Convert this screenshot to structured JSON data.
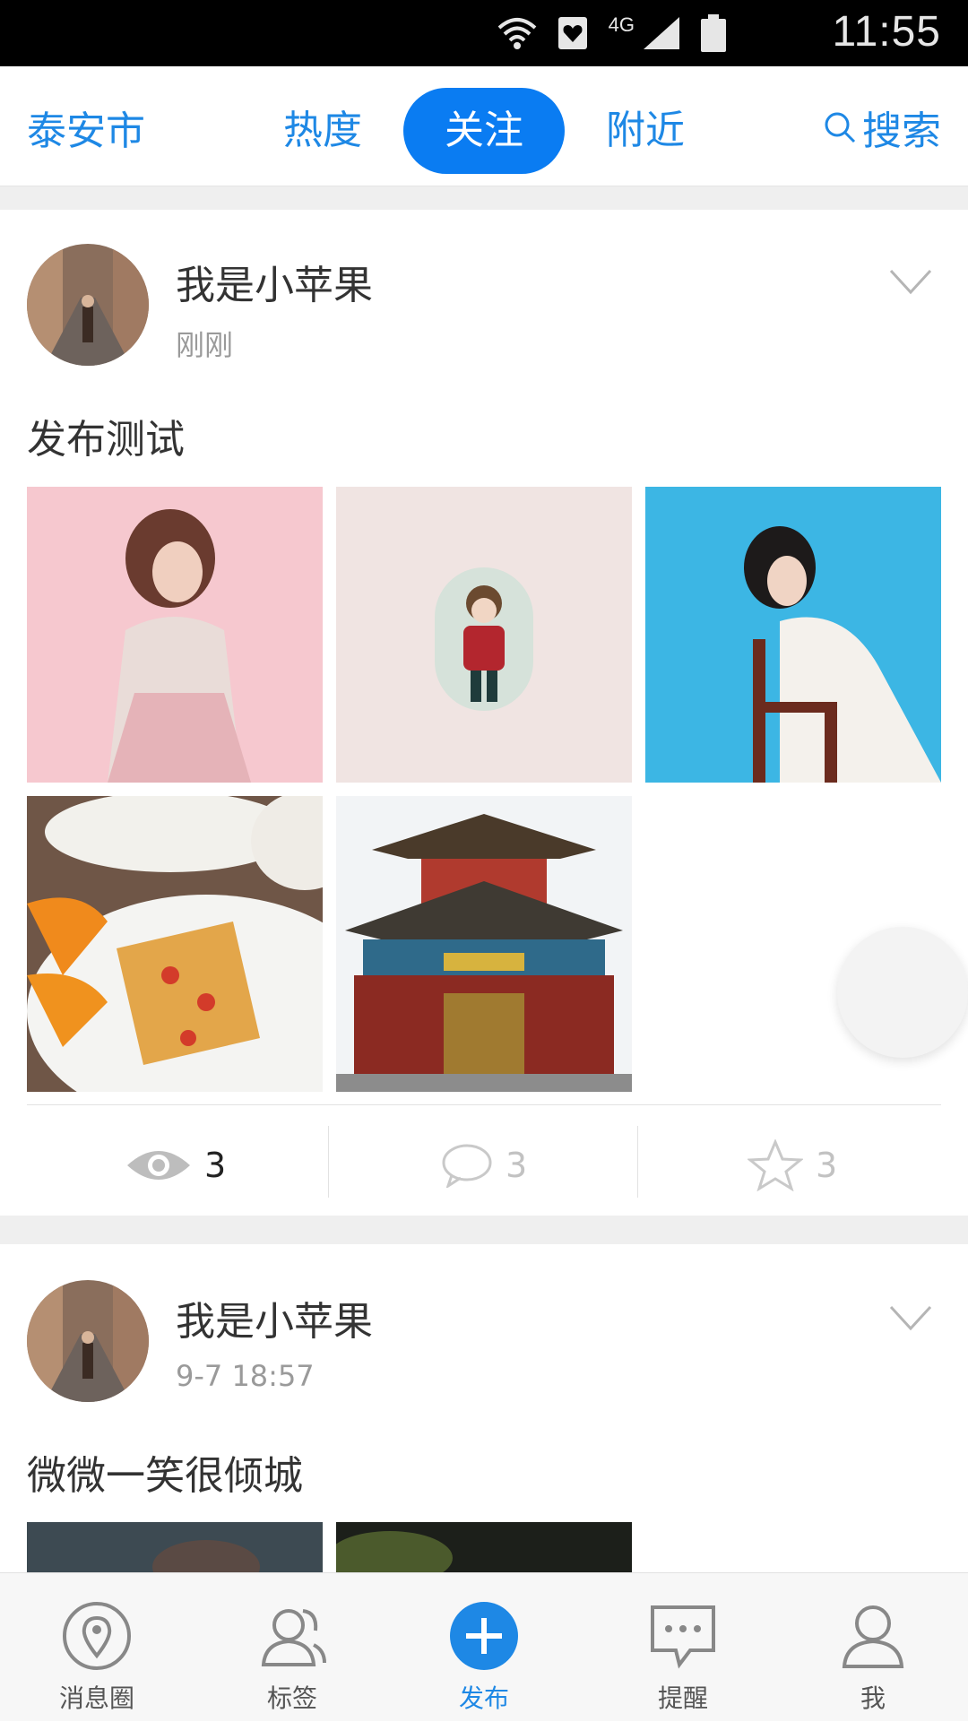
{
  "status_bar": {
    "network": "4G",
    "time": "11:55"
  },
  "top_nav": {
    "city": "泰安市",
    "tabs": [
      {
        "label": "热度",
        "active": false
      },
      {
        "label": "关注",
        "active": true
      },
      {
        "label": "附近",
        "active": false
      }
    ],
    "search_label": "搜索"
  },
  "posts": [
    {
      "username": "我是小苹果",
      "time": "刚刚",
      "text": "发布测试",
      "images": [
        "pink-portrait-photo",
        "cartoon-boy-illustration",
        "blue-portrait-chair-photo",
        "food-plate-photo",
        "pagoda-temple-photo"
      ],
      "stats": {
        "views": "3",
        "comments": "3",
        "favorites": "3"
      }
    },
    {
      "username": "我是小苹果",
      "time": "9-7 18:57",
      "text": "微微一笑很倾城",
      "images": [
        "dark-photo-1",
        "dark-photo-2"
      ]
    }
  ],
  "bottom_nav": {
    "items": [
      {
        "label": "消息圈",
        "icon": "location-pin-icon",
        "active": false
      },
      {
        "label": "标签",
        "icon": "users-icon",
        "active": false
      },
      {
        "label": "发布",
        "icon": "plus-circle-icon",
        "active": true
      },
      {
        "label": "提醒",
        "icon": "message-icon",
        "active": false
      },
      {
        "label": "我",
        "icon": "user-icon",
        "active": false
      }
    ]
  },
  "colors": {
    "accent": "#1e88e5",
    "active_tab_bg": "#0a7cf2",
    "muted": "#9a9a9a"
  }
}
